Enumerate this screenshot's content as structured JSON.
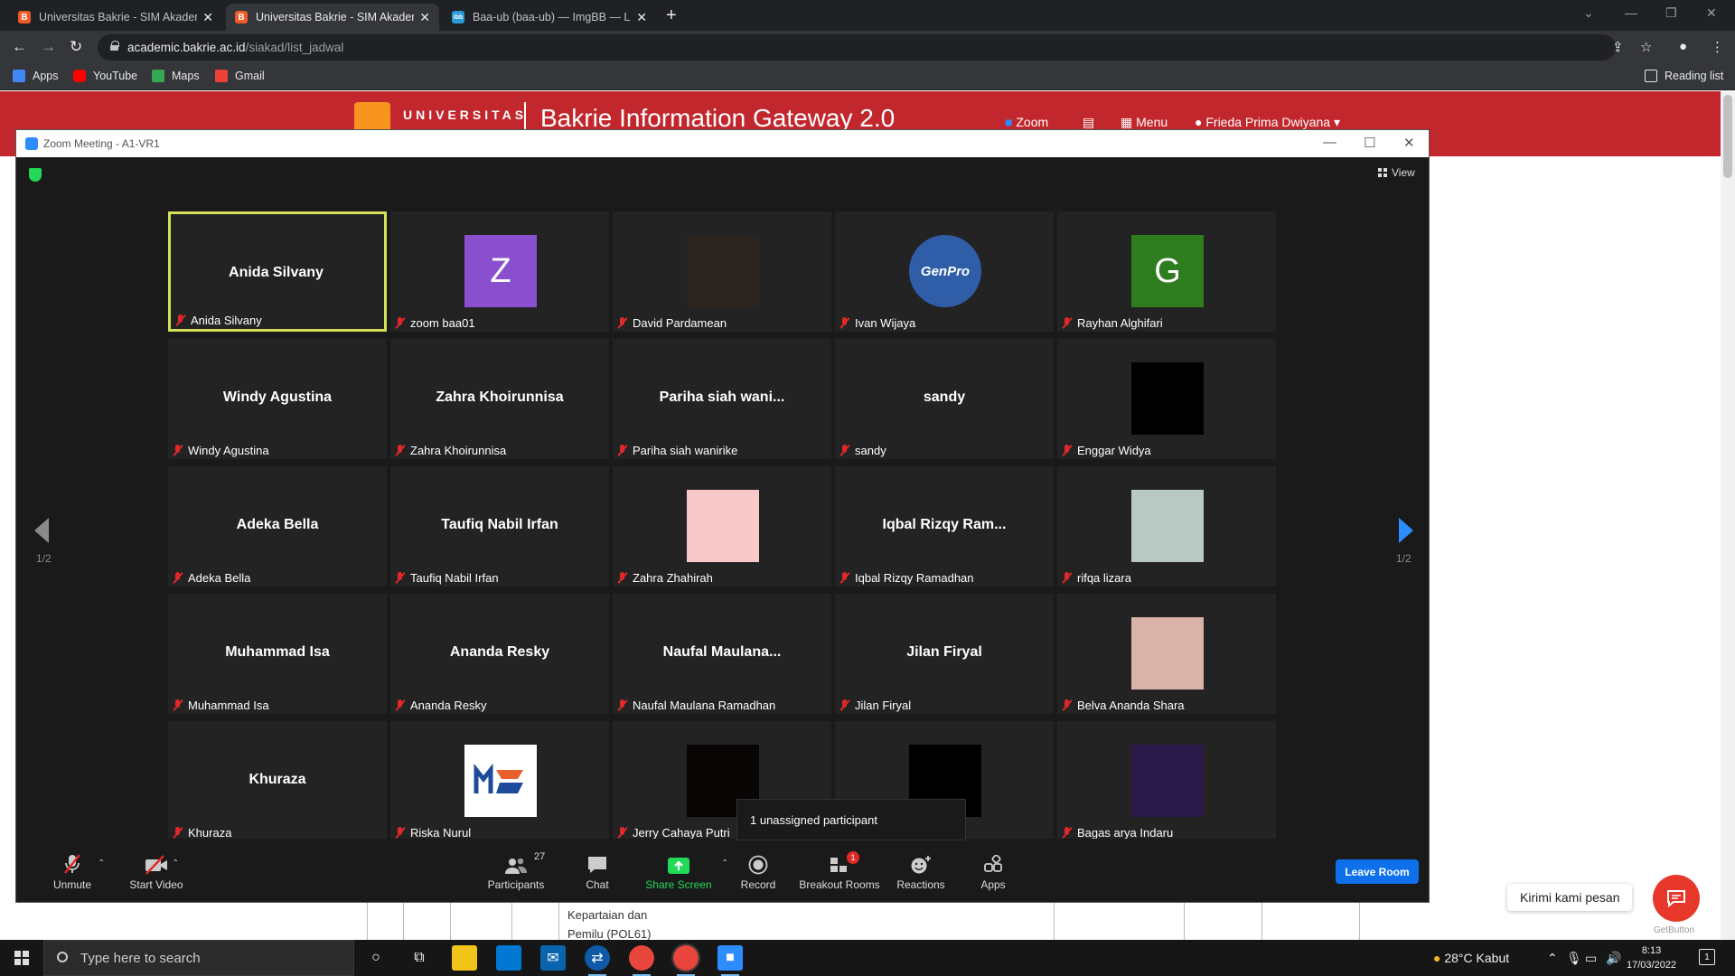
{
  "browser": {
    "tabs": [
      {
        "title": "Universitas Bakrie - SIM Akademik",
        "favicon": "B",
        "active": false
      },
      {
        "title": "Universitas Bakrie - SIM Akademik",
        "favicon": "B",
        "active": true
      },
      {
        "title": "Baa-ub (baa-ub) — ImgBB — Landing",
        "favicon": "ibb",
        "active": false
      }
    ],
    "url_host": "academic.bakrie.ac.id",
    "url_path": "/siakad/list_jadwal",
    "bookmarks": [
      {
        "label": "Apps",
        "color": "#4285f4"
      },
      {
        "label": "YouTube",
        "color": "#ff0000"
      },
      {
        "label": "Maps",
        "color": "#34a853"
      },
      {
        "label": "Gmail",
        "color": "#ea4335"
      }
    ],
    "reading_list": "Reading list"
  },
  "page": {
    "logo_top": "UNIVERSITAS",
    "gateway_title": "Bakrie Information Gateway 2.0",
    "nav_zoom": "Zoom",
    "nav_menu": "Menu",
    "nav_user": "Frieda Prima Dwiyana",
    "table_cell": "Kepartaian dan Pemilu (POL61)",
    "chat_pill": "Kirimi kami pesan",
    "getbutton": "GetButton"
  },
  "zoom": {
    "window_title": "Zoom Meeting - A1-VR1",
    "view_label": "View",
    "page_indicator_left": "1/2",
    "page_indicator_right": "1/2",
    "tooltip": "1 unassigned participant",
    "participants": [
      {
        "display": "Anida Silvany",
        "label": "Anida Silvany",
        "type": "name",
        "active": true
      },
      {
        "display": "Z",
        "label": "zoom baa01",
        "type": "letter",
        "color": "#8a4fcf"
      },
      {
        "display": "",
        "label": "David Pardamean",
        "type": "photo",
        "color": "#2a2520"
      },
      {
        "display": "GenPro",
        "label": "Ivan Wijaya",
        "type": "logo",
        "color": "#2f5da8"
      },
      {
        "display": "G",
        "label": "Rayhan Alghifari",
        "type": "letter",
        "color": "#2e7d1e"
      },
      {
        "display": "Windy Agustina",
        "label": "Windy Agustina",
        "type": "name"
      },
      {
        "display": "Zahra Khoirunnisa",
        "label": "Zahra Khoirunnisa",
        "type": "name"
      },
      {
        "display": "Pariha siah wani...",
        "label": "Pariha siah wanirike",
        "type": "name"
      },
      {
        "display": "sandy",
        "label": "sandy",
        "type": "name"
      },
      {
        "display": "",
        "label": "Enggar Widya",
        "type": "photo",
        "color": "#000000"
      },
      {
        "display": "Adeka Bella",
        "label": "Adeka Bella",
        "type": "name"
      },
      {
        "display": "Taufiq Nabil Irfan",
        "label": "Taufiq Nabil Irfan",
        "type": "name"
      },
      {
        "display": "",
        "label": "Zahra Zhahirah",
        "type": "photo",
        "color": "#f9c9c9"
      },
      {
        "display": "Iqbal Rizqy Ram...",
        "label": "Iqbal Rizqy Ramadhan",
        "type": "name"
      },
      {
        "display": "",
        "label": "rifqa lizara",
        "type": "photo",
        "color": "#b8c9c4"
      },
      {
        "display": "Muhammad Isa",
        "label": "Muhammad Isa",
        "type": "name"
      },
      {
        "display": "Ananda Resky",
        "label": "Ananda Resky",
        "type": "name"
      },
      {
        "display": "Naufal  Maulana...",
        "label": "Naufal Maulana Ramadhan",
        "type": "name"
      },
      {
        "display": "Jilan Firyal",
        "label": "Jilan Firyal",
        "type": "name"
      },
      {
        "display": "",
        "label": "Belva Ananda Shara",
        "type": "photo",
        "color": "#d9b3a8"
      },
      {
        "display": "Khuraza",
        "label": "Khuraza",
        "type": "name"
      },
      {
        "display": "",
        "label": "Riska Nurul",
        "type": "logo",
        "color": "#ffffff"
      },
      {
        "display": "",
        "label": "Jerry Cahaya Putri",
        "type": "photo",
        "color": "#0a0505"
      },
      {
        "display": "",
        "label": "",
        "type": "photo",
        "color": "#000000"
      },
      {
        "display": "",
        "label": "Bagas arya Indaru",
        "type": "photo",
        "color": "#2a1a4a"
      }
    ],
    "toolbar": {
      "unmute": "Unmute",
      "start_video": "Start Video",
      "participants": "Participants",
      "participants_count": "27",
      "chat": "Chat",
      "share_screen": "Share Screen",
      "record": "Record",
      "breakout_rooms": "Breakout Rooms",
      "breakout_badge": "1",
      "reactions": "Reactions",
      "apps": "Apps",
      "leave_room": "Leave Room"
    }
  },
  "taskbar": {
    "search_placeholder": "Type here to search",
    "weather": "28°C  Kabut",
    "time": "8:13",
    "date": "17/03/2022",
    "notification_count": "1"
  }
}
